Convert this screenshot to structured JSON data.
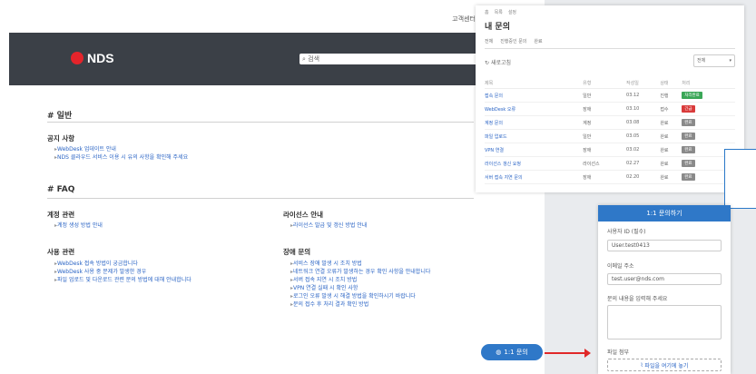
{
  "topnav": {
    "link1": "고객센터",
    "user_icon": "user-icon"
  },
  "hero": {
    "logo_text": "NDS",
    "search_text": "검색"
  },
  "sections": {
    "general": {
      "title": "# 일반",
      "notice": {
        "title": "공지 사항",
        "items": [
          "WebDesk 업데이트 안내",
          "NDS 클라우드 서비스 이용 시 유의 사항을 확인해 주세요"
        ]
      }
    },
    "faq": {
      "title": "# FAQ",
      "account": {
        "title": "계정 관련",
        "items": [
          "계정 생성 방법 안내"
        ]
      },
      "usage": {
        "title": "사용 관련",
        "items": [
          "WebDesk 접속 방법이 궁금합니다",
          "WebDesk 사용 중 문제가 발생한 경우",
          "파일 업로드 및 다운로드 관련 문의 방법에 대해 안내합니다"
        ]
      },
      "license": {
        "title": "라이선스 안내",
        "items": [
          "라이선스 발급 및 갱신 방법 안내"
        ]
      },
      "trouble": {
        "title": "장애 문의",
        "items": [
          "서비스 장애 발생 시 조치 방법",
          "네트워크 연결 오류가 발생하는 경우 확인 사항을 안내합니다",
          "서버 접속 지연 시 조치 방법",
          "VPN 연결 실패 시 확인 사항",
          "로그인 오류 발생 시 해결 방법을 확인하시기 바랍니다",
          "문의 접수 후 처리 결과 확인 방법"
        ]
      }
    }
  },
  "fab_label": "1:1 문의",
  "panel": {
    "tabs": [
      "홈",
      "목록",
      "설정"
    ],
    "title": "내 문의",
    "subnav": [
      "전체",
      "진행중인 문의",
      "완료"
    ],
    "refresh": "새로고침",
    "filter": "전체",
    "headers": [
      "제목",
      "유형",
      "작성일",
      "상태",
      "처리"
    ],
    "rows": [
      {
        "title": "접속 문의",
        "type": "일반",
        "date": "03.12",
        "status": "진행",
        "badge": "처리완료",
        "badge_color": "#3aa757"
      },
      {
        "title": "WebDesk 오류",
        "type": "장애",
        "date": "03.10",
        "status": "접수",
        "badge": "긴급",
        "badge_color": "#d93b3b"
      },
      {
        "title": "계정 문의",
        "type": "계정",
        "date": "03.08",
        "status": "완료",
        "badge": "완료",
        "badge_color": "#8a8a8a"
      },
      {
        "title": "파일 업로드",
        "type": "일반",
        "date": "03.05",
        "status": "완료",
        "badge": "완료",
        "badge_color": "#8a8a8a"
      },
      {
        "title": "VPN 연결",
        "type": "장애",
        "date": "03.02",
        "status": "완료",
        "badge": "완료",
        "badge_color": "#8a8a8a"
      },
      {
        "title": "라이선스 갱신 요청",
        "type": "라이선스",
        "date": "02.27",
        "status": "완료",
        "badge": "완료",
        "badge_color": "#8a8a8a"
      },
      {
        "title": "서버 접속 지연 문의",
        "type": "장애",
        "date": "02.20",
        "status": "완료",
        "badge": "완료",
        "badge_color": "#8a8a8a"
      }
    ]
  },
  "form": {
    "header": "1:1 문의하기",
    "field1_label": "사용자 ID (필수)",
    "field1_value": "User.test0413",
    "field2_label": "이메일 주소",
    "field2_value": "test.user@nds.com",
    "field3_label": "문의 내용을 입력해 주세요",
    "field4_label": "파일 첨부",
    "attach_label": "파일을 여기에 놓기"
  }
}
